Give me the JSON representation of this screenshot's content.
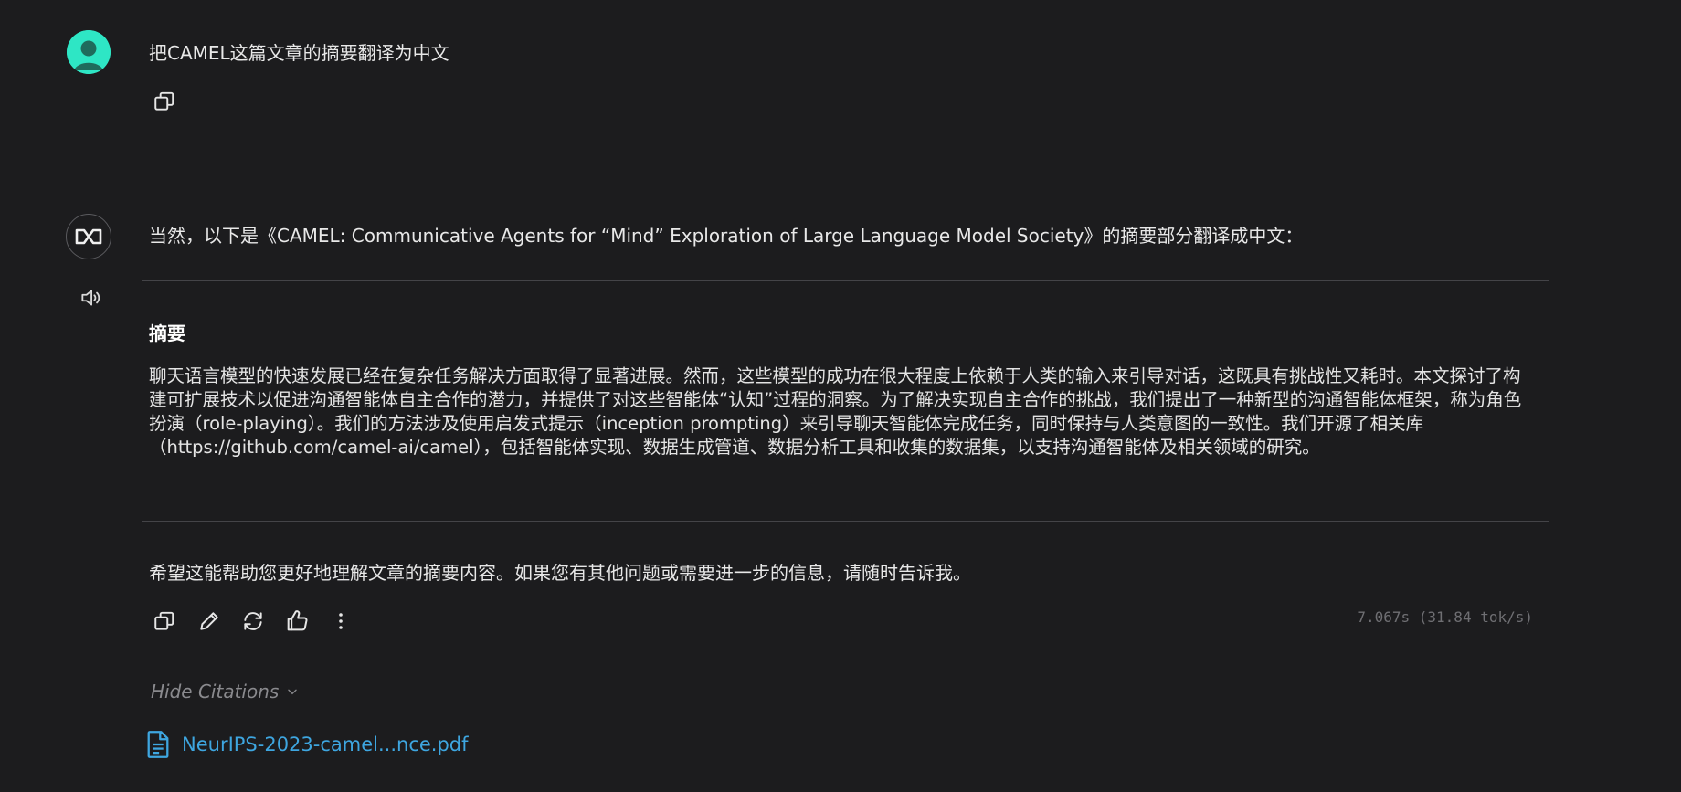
{
  "user_message": {
    "text": "把CAMEL这篇文章的摘要翻译为中文"
  },
  "assistant_message": {
    "intro": "当然，以下是《CAMEL: Communicative Agents for “Mind” Exploration of Large Language Model Society》的摘要部分翻译成中文：",
    "abstract_heading": "摘要",
    "abstract_body": "聊天语言模型的快速发展已经在复杂任务解决方面取得了显著进展。然而，这些模型的成功在很大程度上依赖于人类的输入来引导对话，这既具有挑战性又耗时。本文探讨了构建可扩展技术以促进沟通智能体自主合作的潜力，并提供了对这些智能体“认知”过程的洞察。为了解决实现自主合作的挑战，我们提出了一种新型的沟通智能体框架，称为角色扮演（role-playing）。我们的方法涉及使用启发式提示（inception prompting）来引导聊天智能体完成任务，同时保持与人类意图的一致性。我们开源了相关库（https://github.com/camel-ai/camel），包括智能体实现、数据生成管道、数据分析工具和收集的数据集，以支持沟通智能体及相关领域的研究。",
    "closing": "希望这能帮助您更好地理解文章的摘要内容。如果您有其他问题或需要进一步的信息，请随时告诉我。",
    "timing": "7.067s (31.84 tok/s)"
  },
  "citations": {
    "toggle_label": "Hide Citations",
    "items": [
      {
        "label": "NeurIPS-2023-camel...nce.pdf",
        "icon": "document-icon"
      }
    ]
  },
  "icons": {
    "user_avatar": "user-avatar-icon",
    "bot_avatar": "camel-logo-icon",
    "copy": "copy-icon",
    "speaker": "speaker-icon",
    "edit": "edit-icon",
    "regenerate": "regenerate-icon",
    "like": "thumbs-up-icon",
    "more": "more-vertical-icon"
  },
  "colors": {
    "background": "#1c1c1e",
    "user_avatar": "#2ee6c5",
    "link": "#3ea6e0",
    "muted": "#6f6f73"
  }
}
